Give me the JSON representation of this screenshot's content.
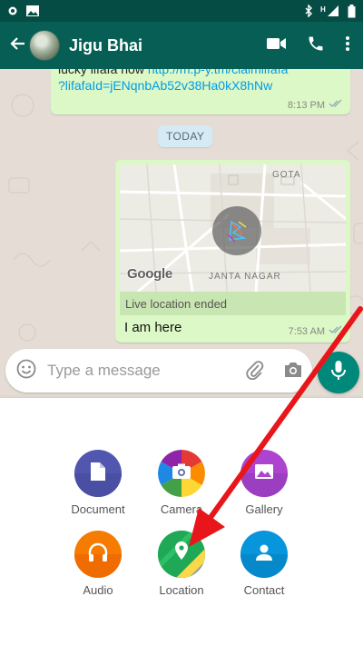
{
  "status_bar": {
    "icons": [
      "notification-dot-icon",
      "image-icon",
      "bluetooth-icon",
      "signal-h-icon",
      "battery-icon"
    ]
  },
  "header": {
    "contact_name": "Jigu Bhai",
    "icons": [
      "back-arrow-icon",
      "video-call-icon",
      "phone-icon",
      "more-vert-icon"
    ]
  },
  "messages": [
    {
      "type": "text",
      "direction": "outgoing",
      "text_line1_plain": "lucky lifafa now ",
      "text_line1_link": "http://m.p-y.tm/claimlifafa",
      "text_line2_link": "?lifafaId=jENqnbAb52v38Ha0kX8hNw",
      "time": "8:13 PM",
      "status": "read"
    },
    {
      "type": "date_separator",
      "label": "TODAY"
    },
    {
      "type": "live_location",
      "direction": "outgoing",
      "map_labels": [
        "GOTA",
        "JANTA NAGAR"
      ],
      "map_brand": "Google",
      "status_text": "Live location ended",
      "caption": "I am here",
      "time": "7:53 AM",
      "status": "read"
    }
  ],
  "composer": {
    "placeholder": "Type a message",
    "value": ""
  },
  "attach_menu": {
    "items": [
      {
        "label": "Document",
        "icon": "document-icon",
        "color": "#5157ae"
      },
      {
        "label": "Camera",
        "icon": "camera-icon",
        "color": "#e53935"
      },
      {
        "label": "Gallery",
        "icon": "gallery-icon",
        "color": "#ac44cf"
      },
      {
        "label": "Audio",
        "icon": "headphones-icon",
        "color": "#f57c00"
      },
      {
        "label": "Location",
        "icon": "location-pin-icon",
        "color": "#1fa855"
      },
      {
        "label": "Contact",
        "icon": "contact-icon",
        "color": "#0795dc"
      }
    ]
  },
  "colors": {
    "app_bar": "#075e54",
    "status_bar": "#054d44",
    "chat_background": "#e5ddd5",
    "outgoing_bubble": "#dcf8c6",
    "mic_button": "#00897b",
    "annotation_arrow": "#e8161b"
  }
}
